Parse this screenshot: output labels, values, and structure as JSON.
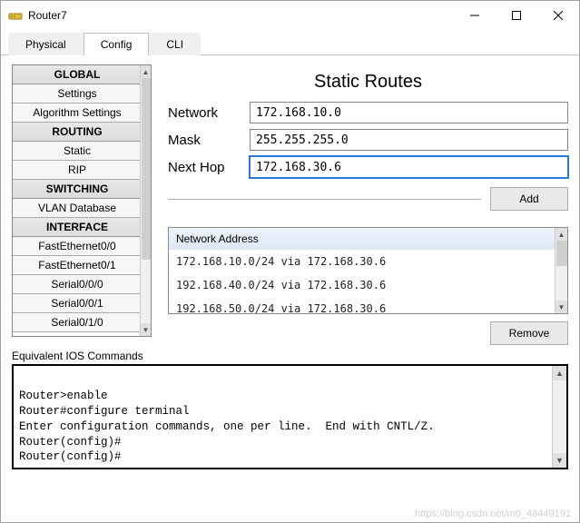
{
  "window": {
    "title": "Router7"
  },
  "tabs": {
    "physical": "Physical",
    "config": "Config",
    "cli": "CLI",
    "active": "config"
  },
  "sidebar": {
    "sections": [
      {
        "header": "GLOBAL",
        "items": [
          "Settings",
          "Algorithm Settings"
        ]
      },
      {
        "header": "ROUTING",
        "items": [
          "Static",
          "RIP"
        ]
      },
      {
        "header": "SWITCHING",
        "items": [
          "VLAN Database"
        ]
      },
      {
        "header": "INTERFACE",
        "items": [
          "FastEthernet0/0",
          "FastEthernet0/1",
          "Serial0/0/0",
          "Serial0/0/1",
          "Serial0/1/0"
        ]
      }
    ]
  },
  "pane": {
    "title": "Static Routes",
    "labels": {
      "network": "Network",
      "mask": "Mask",
      "nexthop": "Next Hop"
    },
    "values": {
      "network": "172.168.10.0",
      "mask": "255.255.255.0",
      "nexthop": "172.168.30.6"
    },
    "add_btn": "Add",
    "remove_btn": "Remove",
    "list_header": "Network Address",
    "routes": [
      "172.168.10.0/24 via 172.168.30.6",
      "192.168.40.0/24 via 172.168.30.6",
      "192.168.50.0/24 via 172.168.30.6"
    ]
  },
  "ios": {
    "label": "Equivalent IOS Commands",
    "lines": "\nRouter>enable\nRouter#configure terminal\nEnter configuration commands, one per line.  End with CNTL/Z.\nRouter(config)#\nRouter(config)#"
  },
  "watermark": "https://blog.csdn.net/m0_48449191"
}
